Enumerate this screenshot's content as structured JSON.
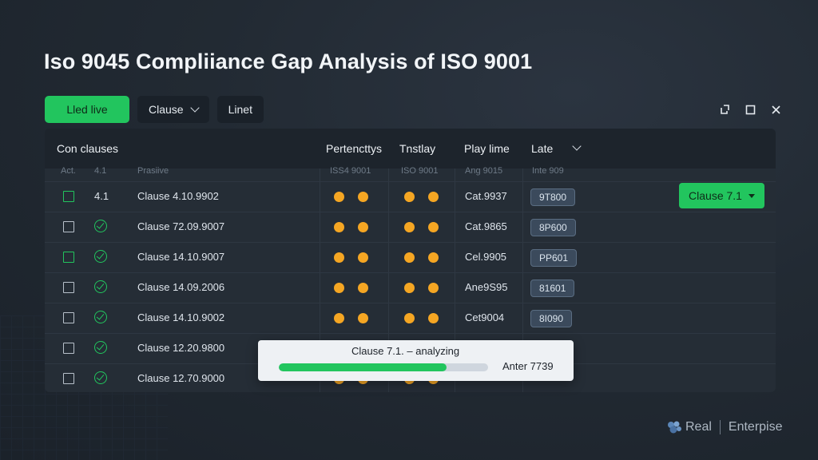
{
  "title": "Iso 9045 Compliiance Gap Analysis of ISO 9001",
  "toolbar": {
    "primary_label": "Lled live",
    "dropdown_label": "Clause",
    "filter_label": "Linet"
  },
  "window_controls": [
    "restore-icon",
    "maximize-icon",
    "close-icon"
  ],
  "table": {
    "columns": [
      "Con clauses",
      "Pertencttys",
      "Tnstlay",
      "Play lime",
      "Late"
    ],
    "subheaders": [
      "Act.",
      "4.1",
      "Prasiive",
      "ISS4 9001",
      "ISO 9001",
      "Ang 9015",
      "Inte 909"
    ],
    "rows": [
      {
        "id": "4.1",
        "clause": "Clause 4.10.9902",
        "ref": "Cat.9937",
        "badge": "9T800",
        "checkbox": "green",
        "status": "none"
      },
      {
        "id": "",
        "clause": "Clause 72.09.9007",
        "ref": "Cat.9865",
        "badge": "8P600",
        "checkbox": "default",
        "status": "check"
      },
      {
        "id": "",
        "clause": "Clause 14.10.9007",
        "ref": "Cel.9905",
        "badge": "PP601",
        "checkbox": "green",
        "status": "check"
      },
      {
        "id": "",
        "clause": "Clause 14.09.2006",
        "ref": "Ane9S95",
        "badge": "81601",
        "checkbox": "default",
        "status": "check"
      },
      {
        "id": "",
        "clause": "Clause 14.10.9002",
        "ref": "Cet9004",
        "badge": "8I090",
        "checkbox": "default",
        "status": "check"
      },
      {
        "id": "",
        "clause": "Clause 12.20.9800",
        "ref": "",
        "badge": "",
        "checkbox": "default",
        "status": "check"
      },
      {
        "id": "",
        "clause": "Clause 12.70.9000",
        "ref": "",
        "badge": "",
        "checkbox": "default",
        "status": "check"
      }
    ]
  },
  "clause_button": "Clause 7.1",
  "progress": {
    "label": "Clause 7.1. – analyzing",
    "right_text": "Anter 7739",
    "value": 0.8
  },
  "brand": {
    "name": "Real",
    "suffix": "Enterpise"
  },
  "colors": {
    "accent": "#22c55e",
    "dot": "#f5a623",
    "background": "#1f2730"
  }
}
